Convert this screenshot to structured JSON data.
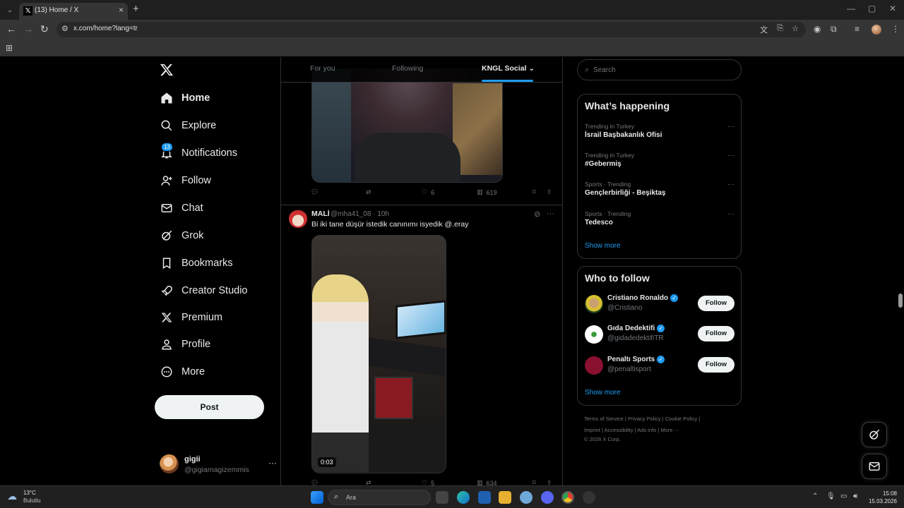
{
  "browser": {
    "tab_title": "(13) Home / X",
    "url": "x.com/home?lang=tr"
  },
  "nav": {
    "items": [
      {
        "label": "Home",
        "icon": "home-icon",
        "active": true
      },
      {
        "label": "Explore",
        "icon": "search-icon"
      },
      {
        "label": "Notifications",
        "icon": "bell-icon",
        "badge": "13"
      },
      {
        "label": "Follow",
        "icon": "add-user-icon"
      },
      {
        "label": "Chat",
        "icon": "mail-icon"
      },
      {
        "label": "Grok",
        "icon": "grok-icon"
      },
      {
        "label": "Bookmarks",
        "icon": "bookmark-icon"
      },
      {
        "label": "Creator Studio",
        "icon": "rocket-icon"
      },
      {
        "label": "Premium",
        "icon": "x-icon"
      },
      {
        "label": "Profile",
        "icon": "person-icon"
      },
      {
        "label": "More",
        "icon": "more-circle-icon"
      }
    ],
    "post_label": "Post",
    "account": {
      "name": "gigii",
      "handle": "@gigiamagizemmis"
    }
  },
  "feed": {
    "tabs": [
      "For you",
      "Following",
      "KNGL Social"
    ],
    "active_tab": "KNGL Social",
    "tweet1": {
      "likes": "6",
      "views": "619"
    },
    "tweet2": {
      "name": "MALİ",
      "handle_time": "@mha41_08 · 10h",
      "text": "Bi iki tane düşür istedik canınımı isyedik @.eray",
      "duration": "0:03",
      "likes": "5",
      "views": "634"
    }
  },
  "sidebar": {
    "search_placeholder": "Search",
    "happening_title": "What’s happening",
    "trends": [
      {
        "context": "Trending in Turkey",
        "title": "İsrail Başbakanlık Ofisi"
      },
      {
        "context": "Trending in Turkey",
        "title": "#Gebermiş"
      },
      {
        "context": "Sports · Trending",
        "title": "Gençlerbirliği - Beşiktaş"
      },
      {
        "context": "Sports · Trending",
        "title": "Tedesco"
      }
    ],
    "show_more": "Show more",
    "wtf_title": "Who to follow",
    "who_to_follow": [
      {
        "name": "Cristiano Ronaldo",
        "handle": "@Cristiano",
        "follow": "Follow"
      },
      {
        "name": "Gıda Dedektifi",
        "handle": "@gidadedektifiTR",
        "follow": "Follow"
      },
      {
        "name": "Penaltı Sports",
        "handle": "@penaltisport",
        "follow": "Follow"
      }
    ],
    "footer_line1": "Terms of Service  |  Privacy Policy  |  Cookie Policy  |",
    "footer_line2": "Imprint  |  Accessibility  |  Ads info  |  More ···",
    "footer_line3": "© 2026 X Corp."
  },
  "taskbar": {
    "temp": "13°C",
    "condition": "Bulutlu",
    "search_placeholder": "Ara",
    "time": "15:08",
    "date": "15.03.2026"
  },
  "colors": {
    "accent": "#1d9bf0",
    "background": "#000000",
    "border": "#2f3336"
  }
}
